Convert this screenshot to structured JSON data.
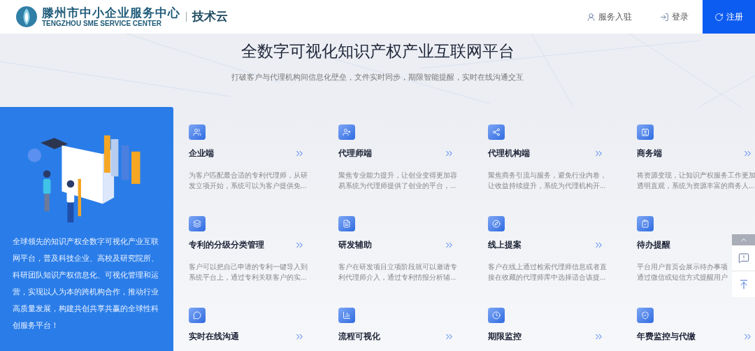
{
  "header": {
    "logo_title": "滕州市中小企业服务中心",
    "logo_subtitle": "TENGZHOU SME SERVICE CENTER",
    "product": "技术云",
    "nav": [
      {
        "kind": "service",
        "label": "服务入驻"
      },
      {
        "kind": "login",
        "label": "登录"
      },
      {
        "kind": "register",
        "label": "注册"
      }
    ]
  },
  "hero": {
    "title": "全数字可视化知识产权产业互联网平台",
    "subtitle": "打破客户与代理机构间信息化壁垒，文件实时同步，期限智能提醒，实时在线沟通交互"
  },
  "intro": {
    "text": "全球领先的知识产权全数字可视化产业互联网平台，普及科技企业、高校及研究院所、科研团队知识产权信息化、可视化管理和运营，实现以人为本的跨机构合作，推动行业高质量发展，构建共创共享共赢的全球性科创服务平台！"
  },
  "features": [
    {
      "title": "企业端",
      "arrow": true,
      "desc": [
        "为客户匹配最合适的专利代理师，从研",
        "发立项开始，系统可以为客户提供免..."
      ]
    },
    {
      "title": "代理师端",
      "arrow": true,
      "desc": [
        "聚焦专业能力提升，让创业变得更加容",
        "易系统为代理师提供了创业的平台，..."
      ]
    },
    {
      "title": "代理机构端",
      "arrow": true,
      "desc": [
        "聚焦商务引流与服务，避免行业内卷，",
        "让收益持续提升，系统为代理机构开..."
      ]
    },
    {
      "title": "商务端",
      "arrow": true,
      "desc": [
        "将资源变现，让知识产权服务工作更加",
        "透明直观，系统为资源丰富的商务人..."
      ]
    },
    {
      "title": "专利的分级分类管理",
      "arrow": true,
      "desc": [
        "客户可以把自己申请的专利一键导入到",
        "系统平台上，通过专利关联客户的实..."
      ]
    },
    {
      "title": "研发辅助",
      "arrow": true,
      "desc": [
        "客户在研发项目立项阶段就可以邀请专",
        "利代理师介入，通过专利情报分析辅..."
      ]
    },
    {
      "title": "线上提案",
      "arrow": true,
      "desc": [
        "客户在线上通过检索代理师信息或者直",
        "接在收藏的代理师库中选择适合该提..."
      ]
    },
    {
      "title": "待办提醒",
      "arrow": false,
      "desc": [
        "平台用户首页会展示待办事项",
        "通过微信或短信方式提醒用户"
      ]
    },
    {
      "title": "实时在线沟通",
      "arrow": true
    },
    {
      "title": "流程可视化",
      "arrow": true
    },
    {
      "title": "期限监控",
      "arrow": true
    },
    {
      "title": "年费监控与代缴",
      "arrow": true
    }
  ]
}
